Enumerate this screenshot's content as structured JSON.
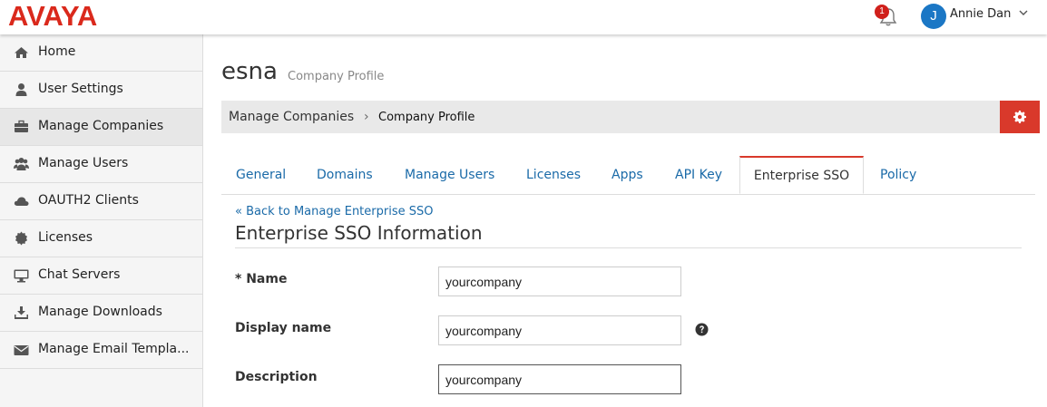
{
  "header": {
    "logo": "AVAYA",
    "notification_count": "1",
    "avatar_initial": "J",
    "user_name": "Annie Dan"
  },
  "sidebar": {
    "items": [
      {
        "label": "Home",
        "icon": "home-icon"
      },
      {
        "label": "User Settings",
        "icon": "user-icon"
      },
      {
        "label": "Manage Companies",
        "icon": "briefcase-icon",
        "active": true
      },
      {
        "label": "Manage Users",
        "icon": "users-icon"
      },
      {
        "label": "OAUTH2 Clients",
        "icon": "cloud-icon"
      },
      {
        "label": "Licenses",
        "icon": "certificate-icon"
      },
      {
        "label": "Chat Servers",
        "icon": "desktop-icon"
      },
      {
        "label": "Manage Downloads",
        "icon": "download-icon"
      },
      {
        "label": "Manage Email Templa...",
        "icon": "envelope-icon"
      }
    ]
  },
  "page": {
    "brand": "esna",
    "subtitle": "Company Profile"
  },
  "breadcrumb": {
    "parent": "Manage Companies",
    "separator": "›",
    "current": "Company Profile"
  },
  "tabs": [
    {
      "label": "General"
    },
    {
      "label": "Domains"
    },
    {
      "label": "Manage Users"
    },
    {
      "label": "Licenses"
    },
    {
      "label": "Apps"
    },
    {
      "label": "API Key"
    },
    {
      "label": "Enterprise SSO",
      "active": true
    },
    {
      "label": "Policy"
    }
  ],
  "sso": {
    "back_link": "« Back to Manage Enterprise SSO",
    "title": "Enterprise SSO Information",
    "fields": {
      "name_label": "* Name",
      "name_value": "yourcompany",
      "display_label": "Display name",
      "display_value": "yourcompany",
      "description_label": "Description",
      "description_value": "yourcompany"
    }
  },
  "colors": {
    "brand_red": "#da291c",
    "link_blue": "#1a6aa8",
    "avatar_blue": "#1b77c5"
  }
}
